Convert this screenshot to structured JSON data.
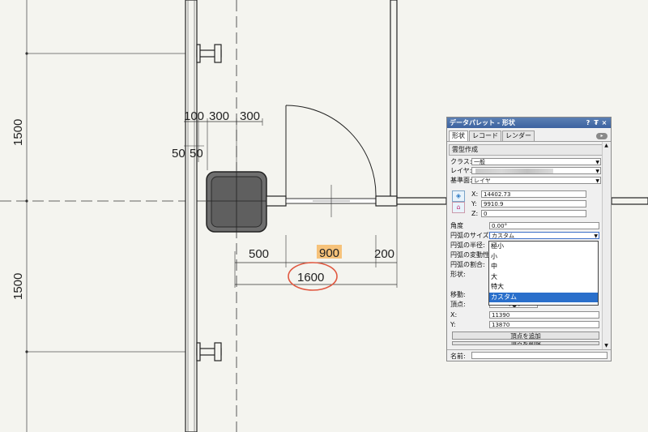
{
  "drawing": {
    "dimensions": {
      "d1500_top": "1500",
      "d1500_bottom": "1500",
      "d100": "100",
      "d300a": "300",
      "d300b": "300",
      "d50a": "50",
      "d50b": "50",
      "d500": "500",
      "d900": "900",
      "d200": "200",
      "d1600": "1600"
    },
    "highlight_color": "#f6c27a",
    "circle_color": "#e0573f"
  },
  "palette": {
    "title": "データパレット - 形状",
    "title_buttons": [
      "?",
      "₮",
      "×"
    ],
    "tabs": [
      "形状",
      "レコード",
      "レンダー"
    ],
    "section": "雲型作成",
    "class_label": "クラス:",
    "class_value": "一般",
    "layer_label": "レイヤ:",
    "plane_label": "基準面:",
    "plane_value": "レイヤ",
    "x_label": "X:",
    "x_value": "14402.73",
    "y_label": "Y:",
    "y_value": "9910.9",
    "z_label": "Z:",
    "z_value": "0",
    "angle_label": "角度",
    "angle_value": "0.00°",
    "arc_size_label": "円弧のサイズ:",
    "arc_size_value": "カスタム",
    "arc_radius_label": "円弧の半径:",
    "arc_var_label": "円弧の変動性:",
    "arc_ratio_label": "円弧の割合:",
    "shape_label": "形状:",
    "dropdown_options": [
      "極小",
      "小",
      "中",
      "大",
      "特大",
      "カスタム"
    ],
    "move_label": "移動:",
    "vertex_label": "頂点:",
    "vx_label": "X:",
    "vx_value": "11390",
    "vy_label": "Y:",
    "vy_value": "13870",
    "add_vertex_btn": "頂点を追加",
    "delete_vertex_btn": "頂点を削除",
    "name_label": "名前:"
  }
}
